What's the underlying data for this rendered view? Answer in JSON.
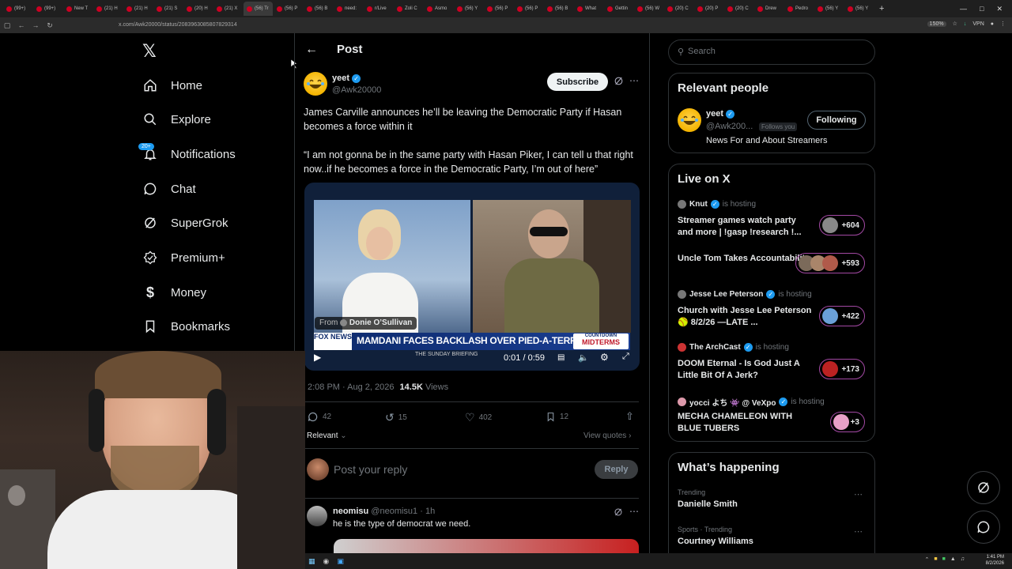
{
  "browser": {
    "tabs": [
      "(99+)",
      "(99+)",
      "New T",
      "(21) H",
      "(21) H",
      "(21) S",
      "(20) H",
      "(21) X",
      "(56) Tr",
      "(56) P",
      "(56) B",
      "need:",
      "r/Live",
      "Zoli C",
      "Asmo",
      "(56) Y",
      "(56) P",
      "(56) P",
      "(56) B",
      "What",
      "Gettin",
      "(56) W",
      "(20) C",
      "(20) P",
      "(20) C",
      "Drew",
      "Pedro",
      "(56) Y",
      "(56) Y"
    ],
    "active_tab_index": 8,
    "url": "x.com/Awk20000/status/2083963085807829314",
    "zoom": "150%",
    "vpn": "VPN"
  },
  "left_nav": {
    "items": [
      {
        "label": "Home",
        "icon": "home-icon"
      },
      {
        "label": "Explore",
        "icon": "search-icon"
      },
      {
        "label": "Notifications",
        "icon": "bell-icon"
      },
      {
        "label": "Chat",
        "icon": "chat-icon"
      },
      {
        "label": "SuperGrok",
        "icon": "grok-icon"
      },
      {
        "label": "Premium+",
        "icon": "premium-icon"
      },
      {
        "label": "Money",
        "icon": "money-icon"
      },
      {
        "label": "Bookmarks",
        "icon": "bookmark-icon"
      }
    ],
    "notifications_badge": "20+"
  },
  "post": {
    "header_title": "Post",
    "author_name": "yeet",
    "author_handle": "@Awk20000",
    "subscribe_label": "Subscribe",
    "text_line1": "James Carville announces he’ll be leaving the Democratic Party if Hasan becomes a force within it",
    "text_quote": "“I am not gonna be in the same party with Hasan Piker, I can tell u that right now..if he becomes a force in the Democratic Party, I’m out of here”",
    "video": {
      "from_label": "From",
      "from_name": "Donie O’Sullivan",
      "chyron": "MAMDANI FACES BACKLASH OVER PIED-A-TERRE TAX",
      "network": "FOX NEWS",
      "sub_chyron": "THE SUNDAY BRIEFING",
      "countdown": "COUNTDOWN",
      "midterms": "MIDTERMS",
      "time": "0:01 / 0:59"
    },
    "timestamp": "2:08 PM · Aug 2, 2026",
    "views_count": "14.5K",
    "views_label": "Views",
    "stats": {
      "replies": "42",
      "reposts": "15",
      "likes": "402",
      "bookmarks": "12"
    },
    "relevant_label": "Relevant",
    "view_quotes_label": "View quotes",
    "reply_placeholder": "Post your reply",
    "reply_button": "Reply"
  },
  "reply": {
    "name": "neomisu",
    "handle": "@neomisu1",
    "time": "· 1h",
    "text": "he is the type of democrat we need."
  },
  "right": {
    "search_placeholder": "Search",
    "relevant_people": {
      "title": "Relevant people",
      "name": "yeet",
      "handle": "@Awk200...",
      "follows_you": "Follows you",
      "following_label": "Following",
      "bio": "News For and About Streamers"
    },
    "live": {
      "title": "Live on X",
      "hosting_label": "is hosting",
      "spaces": [
        {
          "host": "Knut",
          "title": "Streamer games watch party and more | !gasp !research !...",
          "count": "+604"
        },
        {
          "host": "",
          "title": "Uncle Tom Takes Accountability",
          "count": "+593"
        },
        {
          "host": "Jesse Lee Peterson",
          "title": "Church with Jesse Lee Peterson 🥎 8/2/26 —LATE ...",
          "count": "+422"
        },
        {
          "host": "The ArchCast",
          "title": "DOOM Eternal - Is God Just A Little Bit Of A Jerk?",
          "count": "+173"
        },
        {
          "host": "yocci よち 👾 @ VeXpo",
          "title": "MECHA CHAMELEON WITH BLUE TUBERS",
          "count": "+3"
        }
      ]
    },
    "happening": {
      "title": "What’s happening",
      "trends": [
        {
          "context": "Trending",
          "name": "Danielle Smith"
        },
        {
          "context": "Sports · Trending",
          "name": "Courtney Williams"
        }
      ]
    }
  },
  "taskbar": {
    "time": "1:41 PM",
    "date": "8/2/2026"
  }
}
